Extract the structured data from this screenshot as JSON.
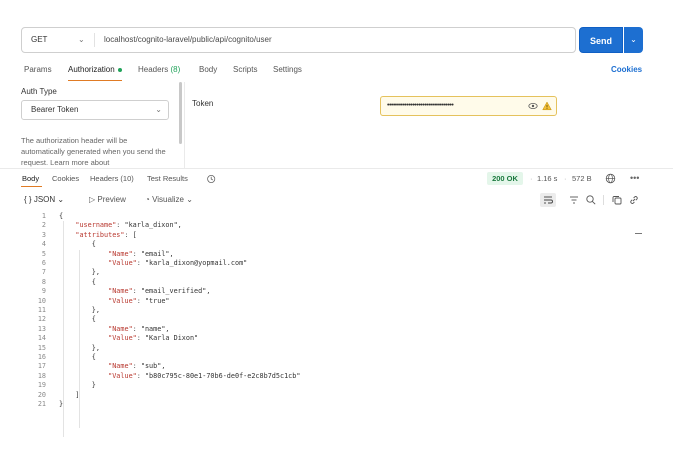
{
  "request": {
    "method": "GET",
    "url": "localhost/cognito-laravel/public/api/cognito/user",
    "send_label": "Send"
  },
  "request_tabs": [
    {
      "label": "Params"
    },
    {
      "label": "Authorization"
    },
    {
      "label": "Headers",
      "count": "(8)"
    },
    {
      "label": "Body"
    },
    {
      "label": "Scripts"
    },
    {
      "label": "Settings"
    }
  ],
  "cookies_label": "Cookies",
  "auth": {
    "type_label": "Auth Type",
    "type_value": "Bearer Token",
    "description": "The authorization header will be automatically generated when you send the request. Learn more about",
    "token_label": "Token",
    "token_masked": "••••••••••••••••••••••••••••••••••"
  },
  "response_tabs": [
    {
      "label": "Body"
    },
    {
      "label": "Cookies"
    },
    {
      "label": "Headers (10)"
    },
    {
      "label": "Test Results"
    }
  ],
  "response_meta": {
    "status": "200 OK",
    "time": "1.16 s",
    "size": "572 B",
    "more": "•••"
  },
  "format": {
    "json_label": "JSON",
    "preview_label": "Preview",
    "visualize_label": "Visualize"
  },
  "icons": {
    "history": "history-icon",
    "globe": "globe-icon",
    "eye": "eye-icon",
    "warning": "warning-icon",
    "wrap": "wrap-icon",
    "filter": "filter-icon",
    "search": "search-icon",
    "copy": "copy-icon",
    "link": "link-icon"
  },
  "colors": {
    "accent": "#1d6fd1",
    "active_tab": "#e07b24",
    "status_ok": "#1c7a3f",
    "json_key": "#b8372e",
    "json_string": "#2a4bb8"
  },
  "code_lines": [
    {
      "n": "1",
      "t": "{"
    },
    {
      "n": "2",
      "t": "    \"username\": \"karla_dixon\","
    },
    {
      "n": "3",
      "t": "    \"attributes\": ["
    },
    {
      "n": "4",
      "t": "        {"
    },
    {
      "n": "5",
      "t": "            \"Name\": \"email\","
    },
    {
      "n": "6",
      "t": "            \"Value\": \"karla_dixon@yopmail.com\""
    },
    {
      "n": "7",
      "t": "        },"
    },
    {
      "n": "8",
      "t": "        {"
    },
    {
      "n": "9",
      "t": "            \"Name\": \"email_verified\","
    },
    {
      "n": "10",
      "t": "            \"Value\": \"true\""
    },
    {
      "n": "11",
      "t": "        },"
    },
    {
      "n": "12",
      "t": "        {"
    },
    {
      "n": "13",
      "t": "            \"Name\": \"name\","
    },
    {
      "n": "14",
      "t": "            \"Value\": \"Karla Dixon\""
    },
    {
      "n": "15",
      "t": "        },"
    },
    {
      "n": "16",
      "t": "        {"
    },
    {
      "n": "17",
      "t": "            \"Name\": \"sub\","
    },
    {
      "n": "18",
      "t": "            \"Value\": \"b80c795c-80e1-70b6-de0f-e2c8b7d5c1cb\""
    },
    {
      "n": "19",
      "t": "        }"
    },
    {
      "n": "20",
      "t": "    ]"
    },
    {
      "n": "21",
      "t": "}"
    }
  ]
}
